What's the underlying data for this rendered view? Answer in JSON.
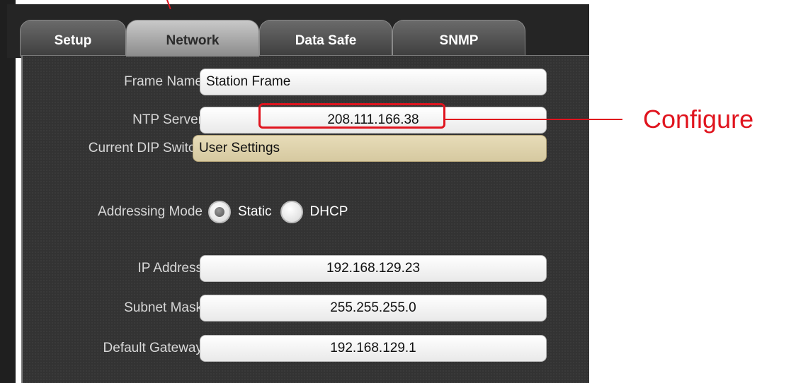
{
  "tabs": [
    {
      "label": "Setup",
      "active": false
    },
    {
      "label": "Network",
      "active": true
    },
    {
      "label": "Data Safe",
      "active": false
    },
    {
      "label": "SNMP",
      "active": false
    }
  ],
  "form": {
    "frame_name": {
      "label": "Frame Name",
      "value": "Station Frame"
    },
    "ntp_server": {
      "label": "NTP Server",
      "value": "208.111.166.38"
    },
    "current_dip_switch": {
      "label": "Current DIP Switch",
      "value": "User Settings"
    },
    "addressing_mode": {
      "label": "Addressing Mode",
      "options": [
        "Static",
        "DHCP"
      ],
      "selected": "Static"
    },
    "ip_address": {
      "label": "IP Address",
      "value": "192.168.129.23"
    },
    "subnet_mask": {
      "label": "Subnet Mask",
      "value": "255.255.255.0"
    },
    "default_gateway": {
      "label": "Default Gateway",
      "value": "192.168.129.1"
    }
  },
  "annotation": {
    "label": "Configure",
    "color": "#e0141e"
  },
  "colors": {
    "panel_bg": "#333333",
    "active_tab": "#b0b0b0",
    "readonly_field": "#e0d4ac"
  }
}
